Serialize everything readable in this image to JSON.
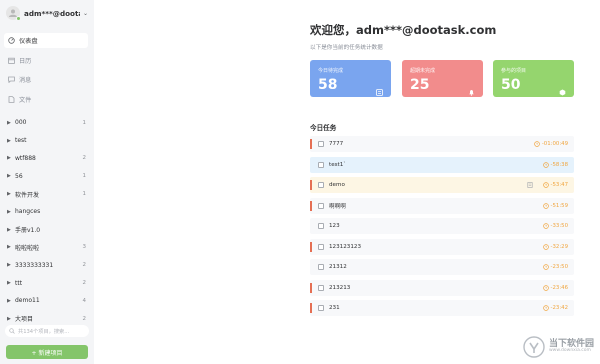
{
  "user": {
    "name": "adm***@dootask.com"
  },
  "nav": [
    {
      "label": "仪表盘",
      "icon": "dashboard-icon",
      "active": true
    },
    {
      "label": "日历",
      "icon": "calendar-icon",
      "active": false
    },
    {
      "label": "消息",
      "icon": "message-icon",
      "active": false
    },
    {
      "label": "文件",
      "icon": "file-icon",
      "active": false
    }
  ],
  "projects": [
    {
      "name": "000",
      "count": "1"
    },
    {
      "name": "test",
      "count": ""
    },
    {
      "name": "wtf888",
      "count": "2"
    },
    {
      "name": "56",
      "count": "1"
    },
    {
      "name": "软件开发",
      "count": "1"
    },
    {
      "name": "hangces",
      "count": ""
    },
    {
      "name": "手册v1.0",
      "count": ""
    },
    {
      "name": "啦啦啦啦",
      "count": "3"
    },
    {
      "name": "3333333331",
      "count": "2"
    },
    {
      "name": "ttt",
      "count": "2"
    },
    {
      "name": "demo11",
      "count": "4"
    },
    {
      "name": "大项目",
      "count": "2"
    }
  ],
  "search": {
    "placeholder": "共134个项目，搜索..."
  },
  "new_project_label": "+ 新建项目",
  "main": {
    "welcome": "欢迎您，adm***@dootask.com",
    "subtitle": "以下是你当前的任务统计数据"
  },
  "cards": [
    {
      "label": "今日待完成",
      "value": "58",
      "icon": "list-icon",
      "color": "#7aa5ef"
    },
    {
      "label": "超期未完成",
      "value": "25",
      "icon": "bell-icon",
      "color": "#f28c8c"
    },
    {
      "label": "参与的项目",
      "value": "50",
      "icon": "cube-icon",
      "color": "#95d56e"
    }
  ],
  "tasks_title": "今日任务",
  "tasks": [
    {
      "name": "7777",
      "time": "-01:00:49",
      "style": "normal",
      "doc": false
    },
    {
      "name": "test1`",
      "time": "-58:38",
      "style": "blue",
      "doc": false
    },
    {
      "name": "demo",
      "time": "-53:47",
      "style": "yellow",
      "doc": true
    },
    {
      "name": "啊啊啊",
      "time": "-51:59",
      "style": "normal",
      "doc": false
    },
    {
      "name": "123",
      "time": "-33:50",
      "style": "normal",
      "doc": false
    },
    {
      "name": "123123123",
      "time": "-32:29",
      "style": "normal",
      "doc": false
    },
    {
      "name": "21312",
      "time": "-23:50",
      "style": "normal",
      "doc": false
    },
    {
      "name": "213213",
      "time": "-23:46",
      "style": "normal",
      "doc": false
    },
    {
      "name": "231",
      "time": "-23:42",
      "style": "normal",
      "doc": false
    }
  ],
  "watermark": {
    "line1": "当下软件园",
    "line2": "www.downxia.com"
  },
  "colors": {
    "accent": "#84c56a",
    "overdue": "#f0a640",
    "task_marker": "#e56f53"
  }
}
